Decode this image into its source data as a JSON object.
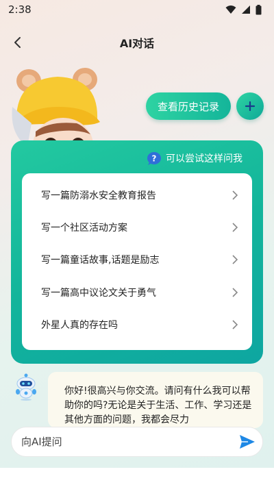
{
  "status": {
    "time": "2:38",
    "icons": [
      "wifi-icon",
      "signal-icon",
      "battery-icon"
    ]
  },
  "nav": {
    "title": "AI对话",
    "back_icon": "chevron-left-icon"
  },
  "actions": {
    "history_label": "查看历史记录",
    "add_icon": "plus-icon"
  },
  "suggestions": {
    "hint": "可以尝试这样问我",
    "hint_icon": "question-bubble-icon",
    "items": [
      {
        "label": "写一篇防溺水安全教育报告"
      },
      {
        "label": "写一个社区活动方案"
      },
      {
        "label": "写一篇童话故事,话题是励志"
      },
      {
        "label": "写一篇高中议论文关于勇气"
      },
      {
        "label": "外星人真的存在吗"
      }
    ]
  },
  "chat": {
    "bot_message": "你好!很高兴与你交流。请问有什么我可以帮助你的吗?无论是关于生活、工作、学习还是其他方面的问题，我都会尽力"
  },
  "composer": {
    "placeholder": "向AI提问",
    "send_icon": "send-icon"
  },
  "colors": {
    "accent": "#1cc19d",
    "accent_dark": "#0ea6a1",
    "send": "#1e88e5"
  }
}
